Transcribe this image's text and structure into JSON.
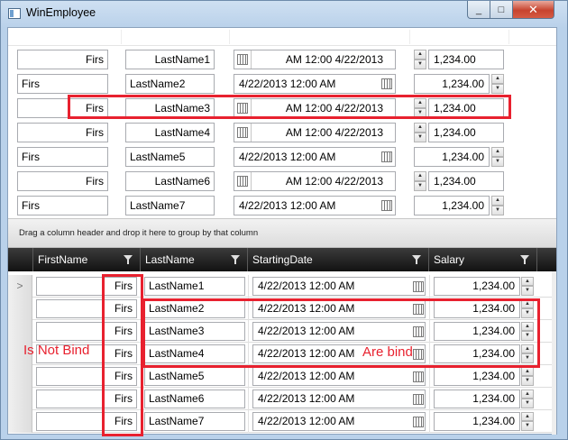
{
  "window": {
    "title": "WinEmployee",
    "min_glyph": "_",
    "max_glyph": "□",
    "close_glyph": "✕"
  },
  "top_rows": [
    {
      "first": "Firs",
      "first_align": "right",
      "last": "LastName1",
      "last_align": "right",
      "date": "AM 12:00 4/22/2013",
      "date_rtl": true,
      "salary": "1,234.00",
      "salary_rtl": true
    },
    {
      "first": "Firs",
      "first_align": "left",
      "last": "LastName2",
      "last_align": "left",
      "date": "4/22/2013 12:00 AM",
      "date_rtl": false,
      "salary": "1,234.00",
      "salary_rtl": false
    },
    {
      "first": "Firs",
      "first_align": "right",
      "last": "LastName3",
      "last_align": "right",
      "date": "AM 12:00 4/22/2013",
      "date_rtl": true,
      "salary": "1,234.00",
      "salary_rtl": true
    },
    {
      "first": "Firs",
      "first_align": "right",
      "last": "LastName4",
      "last_align": "right",
      "date": "AM 12:00 4/22/2013",
      "date_rtl": true,
      "salary": "1,234.00",
      "salary_rtl": true
    },
    {
      "first": "Firs",
      "first_align": "left",
      "last": "LastName5",
      "last_align": "left",
      "date": "4/22/2013 12:00 AM",
      "date_rtl": false,
      "salary": "1,234.00",
      "salary_rtl": false
    },
    {
      "first": "Firs",
      "first_align": "right",
      "last": "LastName6",
      "last_align": "right",
      "date": "AM 12:00 4/22/2013",
      "date_rtl": true,
      "salary": "1,234.00",
      "salary_rtl": true
    },
    {
      "first": "Firs",
      "first_align": "left",
      "last": "LastName7",
      "last_align": "left",
      "date": "4/22/2013 12:00 AM",
      "date_rtl": false,
      "salary": "1,234.00",
      "salary_rtl": false
    }
  ],
  "group_panel": {
    "text": "Drag a column header and drop it here to group by that column"
  },
  "grid": {
    "columns": [
      "FirstName",
      "LastName",
      "StartingDate",
      "Salary"
    ],
    "current_row_glyph": ">",
    "rows": [
      {
        "first": "Firs",
        "last": "LastName1",
        "date": "4/22/2013 12:00 AM",
        "salary": "1,234.00"
      },
      {
        "first": "Firs",
        "last": "LastName2",
        "date": "4/22/2013 12:00 AM",
        "salary": "1,234.00"
      },
      {
        "first": "Firs",
        "last": "LastName3",
        "date": "4/22/2013 12:00 AM",
        "salary": "1,234.00"
      },
      {
        "first": "Firs",
        "last": "LastName4",
        "date": "4/22/2013 12:00 AM",
        "salary": "1,234.00"
      },
      {
        "first": "Firs",
        "last": "LastName5",
        "date": "4/22/2013 12:00 AM",
        "salary": "1,234.00"
      },
      {
        "first": "Firs",
        "last": "LastName6",
        "date": "4/22/2013 12:00 AM",
        "salary": "1,234.00"
      },
      {
        "first": "Firs",
        "last": "LastName7",
        "date": "4/22/2013 12:00 AM",
        "salary": "1,234.00"
      }
    ]
  },
  "annotations": {
    "not_bind": "Is Not Bind",
    "are_bind": "Are bind",
    "color": "#e8212f"
  },
  "icons": {
    "calendar": "calendar-icon",
    "spin_up": "▲",
    "spin_down": "▼",
    "filter": "filter-icon"
  }
}
